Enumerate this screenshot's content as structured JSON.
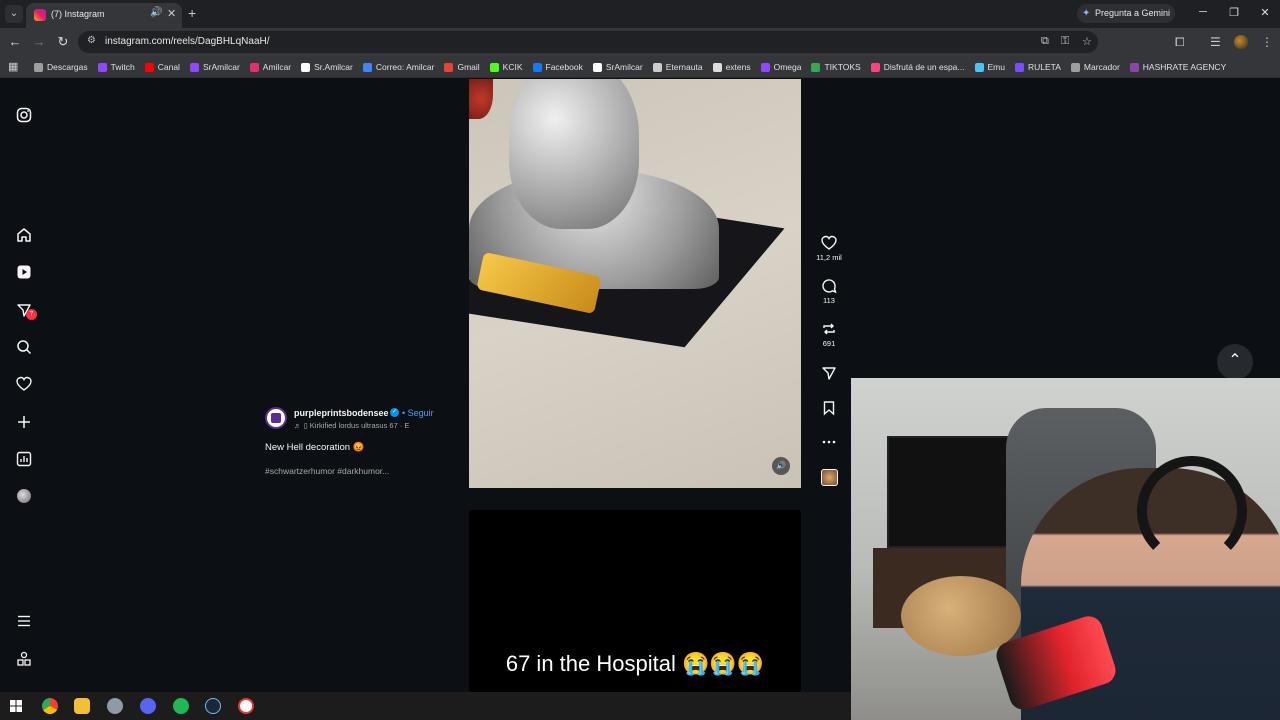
{
  "browser": {
    "tab_title": "(7) Instagram",
    "url": "instagram.com/reels/DagBHLqNaaH/",
    "gemini_label": "Pregunta a Gemini",
    "bookmarks": [
      "Descargas",
      "Twitch",
      "Canal",
      "SrAmilcar",
      "Amilcar",
      "Sr.Amilcar",
      "Correo: Amilcar",
      "Gmail",
      "KCIK",
      "Facebook",
      "SrAmilcar",
      "Eternauta",
      "extens",
      "Omega",
      "TIKTOKS",
      "Disfrutá de un espa...",
      "Emu",
      "RULETA",
      "Marcador",
      "HASHRATE AGENCY"
    ],
    "bookmark_colors": [
      "#9e9e9e",
      "#9146ff",
      "#ff0000",
      "#9146ff",
      "#e1306c",
      "#ffffff",
      "#4285f4",
      "#ea4335",
      "#53fc18",
      "#1877f2",
      "#ffffff",
      "#cccccc",
      "#dddddd",
      "#9146ff",
      "#34a853",
      "#ff4081",
      "#4fc3f7",
      "#7c4dff",
      "#9e9e9e",
      "#8e44ad"
    ]
  },
  "sidebar": {
    "notification_count": "7"
  },
  "reel": {
    "author": "purpleprintsbodensee",
    "follow_label": "Seguir",
    "audio": "Kirkified lordus ultrasus 67 · E",
    "caption": "New Hell decoration 😡",
    "hashtags": "#schwartzerhumor #darkhumor...",
    "likes": "11,2 mil",
    "comments": "113",
    "reposts": "691"
  },
  "next_reel": {
    "text": "67 in the Hospital 😭😭😭"
  },
  "colors": {
    "ig_background": "#0c1014",
    "accent_blue": "#0095f6",
    "badge_red": "#ff3040"
  }
}
